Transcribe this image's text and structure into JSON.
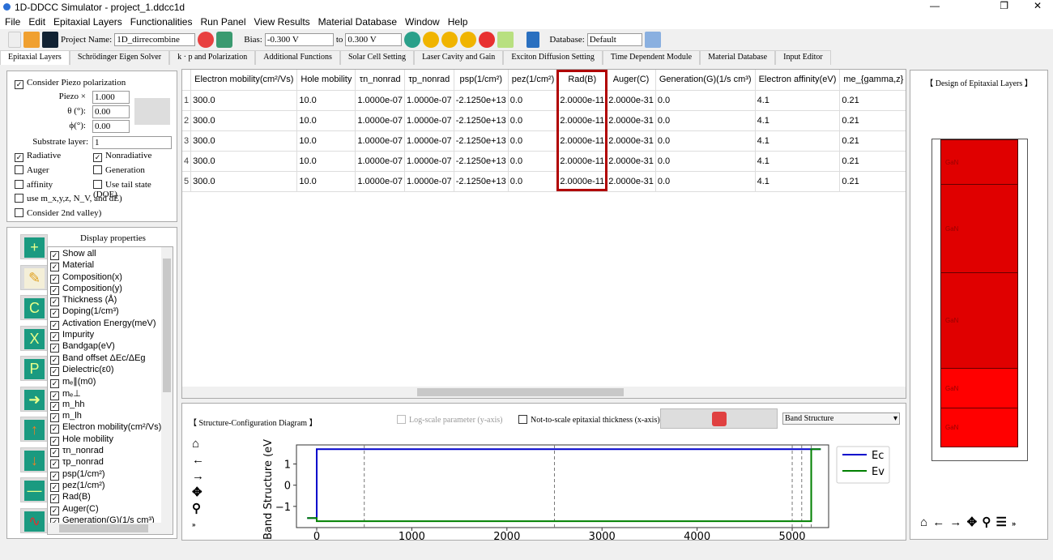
{
  "window": {
    "title": "1D-DDCC Simulator - project_1.ddcc1d"
  },
  "menu": [
    "File",
    "Edit",
    "Epitaxial Layers",
    "Functionalities",
    "Run Panel",
    "View Results",
    "Material Database",
    "Window",
    "Help"
  ],
  "toolbar": {
    "project_label": "Project Name:",
    "project_value": "1D_dirrecombine",
    "bias_label": "Bias:",
    "bias_from": "-0.300 V",
    "to_label": "to",
    "bias_to": "0.300 V",
    "database_label": "Database:",
    "database_value": "Default"
  },
  "tabs": [
    "Epitaxial Layers",
    "Schrödinger Eigen Solver",
    "k · p and Polarization",
    "Additional Functions",
    "Solar Cell Setting",
    "Laser Cavity and Gain",
    "Exciton Diffusion Setting",
    "Time Dependent Module",
    "Material Database",
    "Input Editor"
  ],
  "settings": {
    "piezo_cb": "Consider Piezo polarization",
    "piezo_label": "Piezo ×",
    "piezo_value": "1.000",
    "theta_label": "θ (°):",
    "theta_value": "0.00",
    "phi_label": "ϕ(°):",
    "phi_value": "0.00",
    "substrate_label": "Substrate layer:",
    "substrate_value": "1",
    "checks": [
      {
        "label": "Radiative",
        "checked": true
      },
      {
        "label": "Nonradiative",
        "checked": true
      },
      {
        "label": "Auger",
        "checked": false
      },
      {
        "label": "Generation",
        "checked": false
      },
      {
        "label": "affinity",
        "checked": false
      },
      {
        "label": "Use tail state (DOE)",
        "checked": false
      },
      {
        "label": "use m_x,y,z, N_V, and dE)",
        "checked": false
      },
      {
        "label": "Consider 2nd valley)",
        "checked": false
      }
    ]
  },
  "display": {
    "title": "Display properties",
    "items": [
      "Show all",
      "Material",
      "Composition(x)",
      "Composition(y)",
      "Thickness (Å)",
      "Doping(1/cm³)",
      "Activation Energy(meV)",
      "Impurity",
      "Bandgap(eV)",
      "Band offset ΔEc/ΔEg",
      "Dielectric(ε0)",
      "mₑ∥(m0)",
      "mₑ⊥",
      "m_hh",
      "m_lh",
      "Electron mobility(cm²/Vs)",
      "Hole mobility",
      "τn_nonrad",
      "τp_nonrad",
      "psp(1/cm²)",
      "pez(1/cm²)",
      "Rad(B)",
      "Auger(C)",
      "Generation(G)(1/s cm³)"
    ],
    "tools": [
      "add-icon",
      "edit-pencil-icon",
      "copy-icon",
      "cut-icon",
      "paste-icon",
      "insert-icon",
      "move-up-icon",
      "move-down-icon",
      "remove-icon",
      "plot-icon"
    ]
  },
  "table": {
    "columns": [
      "Electron mobility(cm²/Vs)",
      "Hole mobility",
      "τn_nonrad",
      "τp_nonrad",
      "psp(1/cm²)",
      "pez(1/cm²)",
      "Rad(B)",
      "Auger(C)",
      "Generation(G)(1/s cm³)",
      "Electron affinity(eV)",
      "me_{gamma,z} (m"
    ],
    "rows": [
      [
        "1",
        "300.0",
        "10.0",
        "1.0000e-07",
        "1.0000e-07",
        "-2.1250e+13",
        "0.0",
        "2.0000e-11",
        "2.0000e-31",
        "0.0",
        "4.1",
        "0.21"
      ],
      [
        "2",
        "300.0",
        "10.0",
        "1.0000e-07",
        "1.0000e-07",
        "-2.1250e+13",
        "0.0",
        "2.0000e-11",
        "2.0000e-31",
        "0.0",
        "4.1",
        "0.21"
      ],
      [
        "3",
        "300.0",
        "10.0",
        "1.0000e-07",
        "1.0000e-07",
        "-2.1250e+13",
        "0.0",
        "2.0000e-11",
        "2.0000e-31",
        "0.0",
        "4.1",
        "0.21"
      ],
      [
        "4",
        "300.0",
        "10.0",
        "1.0000e-07",
        "1.0000e-07",
        "-2.1250e+13",
        "0.0",
        "2.0000e-11",
        "2.0000e-31",
        "0.0",
        "4.1",
        "0.21"
      ],
      [
        "5",
        "300.0",
        "10.0",
        "1.0000e-07",
        "1.0000e-07",
        "-2.1250e+13",
        "0.0",
        "2.0000e-11",
        "2.0000e-31",
        "0.0",
        "4.1",
        "0.21"
      ]
    ],
    "highlight_column": "Rad(B)",
    "highlight_color": "#b00000"
  },
  "diagram": {
    "title": "【 Structure-Configuration Diagram 】",
    "log_scale": "Log-scale parameter (y-axis)",
    "not_to_scale": "Not-to-scale epitaxial thickness (x-axis)",
    "plot_select": "Band Structure"
  },
  "chart_data": {
    "type": "line",
    "ylabel": "Band Structure (eV",
    "xlim": [
      -213,
      5383
    ],
    "ylim": [
      -2,
      1.9
    ],
    "xticks": [
      "0",
      "1000",
      "2000",
      "3000",
      "4000",
      "5000"
    ],
    "yticks": [
      "1",
      "0",
      "−1"
    ],
    "legend": "right",
    "series": [
      {
        "name": "Ec",
        "color": "#0000cc",
        "points": [
          [
            -100,
            -1.55
          ],
          [
            0,
            -1.55
          ],
          [
            0,
            1.7
          ],
          [
            5200,
            1.7
          ],
          [
            5300,
            1.7
          ]
        ]
      },
      {
        "name": "Ev",
        "color": "#008000",
        "points": [
          [
            -100,
            -1.55
          ],
          [
            0,
            -1.55
          ],
          [
            0,
            -1.7
          ],
          [
            5200,
            -1.7
          ],
          [
            5200,
            1.7
          ],
          [
            5300,
            1.7
          ]
        ]
      }
    ],
    "boundaries": [
      500,
      2500,
      5000,
      5100,
      5200
    ]
  },
  "layers": {
    "title": "【 Design of Epitaxial Layers 】",
    "items": [
      "GaN",
      "GaN",
      "GaN",
      "GaN",
      "GaN"
    ],
    "colors": [
      "#e00000",
      "#e00000",
      "#e00000",
      "#ff0000",
      "#ff0000"
    ]
  }
}
